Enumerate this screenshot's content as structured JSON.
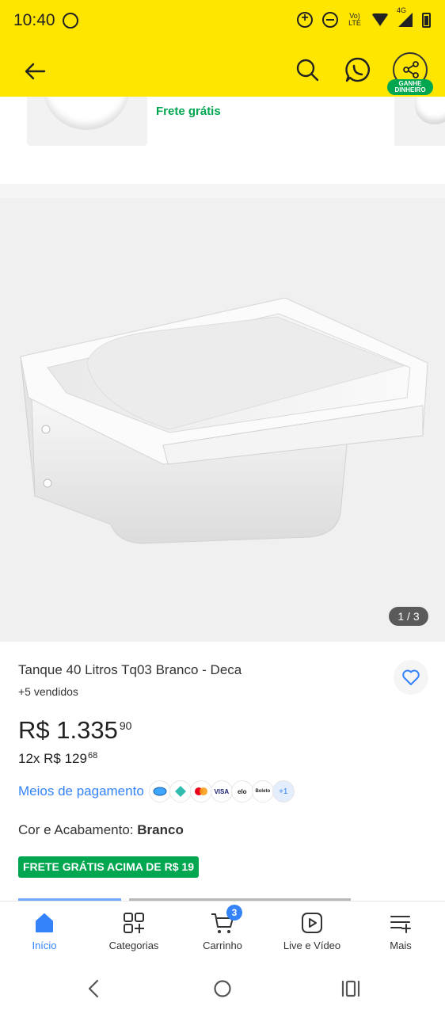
{
  "status_bar": {
    "time": "10:40",
    "volte": "Vo) LTE",
    "network": "4G"
  },
  "header": {
    "back_label": "Voltar",
    "share_badge": "GANHE DINHEIRO"
  },
  "related": {
    "shipping": "Frete grátis"
  },
  "gallery": {
    "counter": "1 / 3"
  },
  "product": {
    "title": "Tanque 40 Litros Tq03 Branco - Deca",
    "sold": "+5 vendidos",
    "price_main": "R$ 1.335",
    "price_cents": "90",
    "installments_main": "12x R$ 129",
    "installments_cents": "68",
    "payment_label": "Meios de pagamento",
    "payment_methods": [
      "mercado-pago",
      "pix",
      "mastercard",
      "VISA",
      "elo",
      "Boleto"
    ],
    "payment_more": "+1",
    "color_label": "Cor e Acabamento:",
    "color_value": "Branco",
    "shipping_badge": "FRETE GRÁTIS ACIMA DE R$ 19"
  },
  "tabs": [
    {
      "label": "Início",
      "icon": "home-icon",
      "active": true
    },
    {
      "label": "Categorias",
      "icon": "categories-icon",
      "active": false
    },
    {
      "label": "Carrinho",
      "icon": "cart-icon",
      "active": false,
      "badge": "3"
    },
    {
      "label": "Live e Vídeo",
      "icon": "play-icon",
      "active": false
    },
    {
      "label": "Mais",
      "icon": "menu-icon",
      "active": false
    }
  ],
  "colors": {
    "header_yellow": "#ffe600",
    "accent_blue": "#3483fa",
    "green": "#00a650"
  }
}
